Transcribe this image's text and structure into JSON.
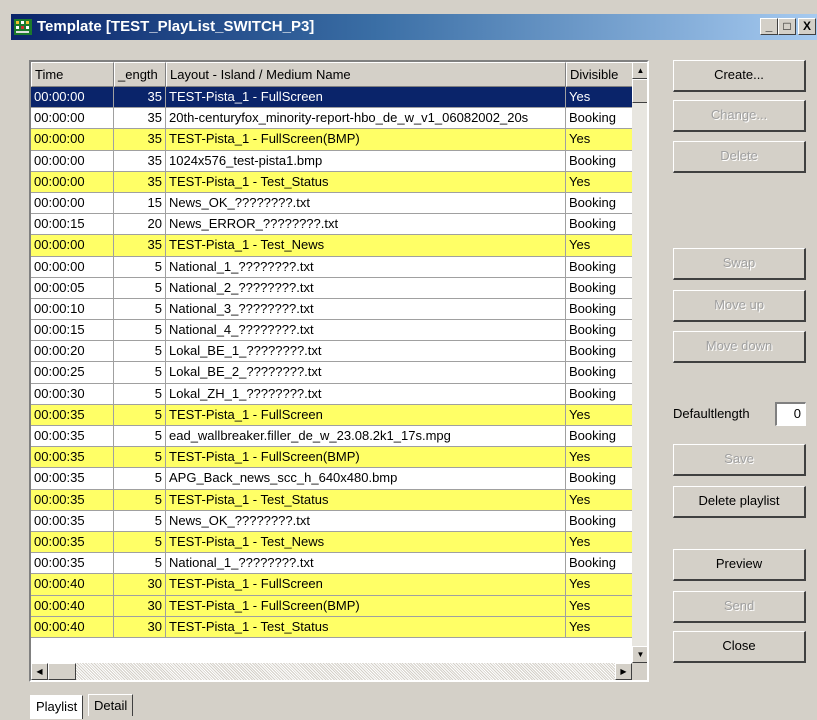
{
  "window": {
    "title": "Template [TEST_PlayList_SWITCH_P3]",
    "buttons": {
      "minimize": "_",
      "maximize": "□",
      "close": "X"
    }
  },
  "columns": [
    "Time",
    "_ength",
    "Layout - Island / Medium Name",
    "Divisible"
  ],
  "rows": [
    {
      "time": "00:00:00",
      "length": "35",
      "name": "TEST-Pista_1 - FullScreen",
      "divisible": "Yes",
      "style": "selected"
    },
    {
      "time": "00:00:00",
      "length": "35",
      "name": "20th-centuryfox_minority-report-hbo_de_w_v1_06082002_20s",
      "divisible": "Booking",
      "style": "white"
    },
    {
      "time": "00:00:00",
      "length": "35",
      "name": "TEST-Pista_1 - FullScreen(BMP)",
      "divisible": "Yes",
      "style": "yellow"
    },
    {
      "time": "00:00:00",
      "length": "35",
      "name": "1024x576_test-pista1.bmp",
      "divisible": "Booking",
      "style": "white"
    },
    {
      "time": "00:00:00",
      "length": "35",
      "name": "TEST-Pista_1 - Test_Status",
      "divisible": "Yes",
      "style": "yellow"
    },
    {
      "time": "00:00:00",
      "length": "15",
      "name": "News_OK_????????.txt",
      "divisible": "Booking",
      "style": "white"
    },
    {
      "time": "00:00:15",
      "length": "20",
      "name": "News_ERROR_????????.txt",
      "divisible": "Booking",
      "style": "white"
    },
    {
      "time": "00:00:00",
      "length": "35",
      "name": "TEST-Pista_1 - Test_News",
      "divisible": "Yes",
      "style": "yellow"
    },
    {
      "time": "00:00:00",
      "length": "5",
      "name": "National_1_????????.txt",
      "divisible": "Booking",
      "style": "white"
    },
    {
      "time": "00:00:05",
      "length": "5",
      "name": "National_2_????????.txt",
      "divisible": "Booking",
      "style": "white"
    },
    {
      "time": "00:00:10",
      "length": "5",
      "name": "National_3_????????.txt",
      "divisible": "Booking",
      "style": "white"
    },
    {
      "time": "00:00:15",
      "length": "5",
      "name": "National_4_????????.txt",
      "divisible": "Booking",
      "style": "white"
    },
    {
      "time": "00:00:20",
      "length": "5",
      "name": "Lokal_BE_1_????????.txt",
      "divisible": "Booking",
      "style": "white"
    },
    {
      "time": "00:00:25",
      "length": "5",
      "name": "Lokal_BE_2_????????.txt",
      "divisible": "Booking",
      "style": "white"
    },
    {
      "time": "00:00:30",
      "length": "5",
      "name": "Lokal_ZH_1_????????.txt",
      "divisible": "Booking",
      "style": "white"
    },
    {
      "time": "00:00:35",
      "length": "5",
      "name": "TEST-Pista_1 - FullScreen",
      "divisible": "Yes",
      "style": "yellow"
    },
    {
      "time": "00:00:35",
      "length": "5",
      "name": "ead_wallbreaker.filler_de_w_23.08.2k1_17s.mpg",
      "divisible": "Booking",
      "style": "white"
    },
    {
      "time": "00:00:35",
      "length": "5",
      "name": "TEST-Pista_1 - FullScreen(BMP)",
      "divisible": "Yes",
      "style": "yellow"
    },
    {
      "time": "00:00:35",
      "length": "5",
      "name": "APG_Back_news_scc_h_640x480.bmp",
      "divisible": "Booking",
      "style": "white"
    },
    {
      "time": "00:00:35",
      "length": "5",
      "name": "TEST-Pista_1 - Test_Status",
      "divisible": "Yes",
      "style": "yellow"
    },
    {
      "time": "00:00:35",
      "length": "5",
      "name": "News_OK_????????.txt",
      "divisible": "Booking",
      "style": "white"
    },
    {
      "time": "00:00:35",
      "length": "5",
      "name": "TEST-Pista_1 - Test_News",
      "divisible": "Yes",
      "style": "yellow"
    },
    {
      "time": "00:00:35",
      "length": "5",
      "name": "National_1_????????.txt",
      "divisible": "Booking",
      "style": "white"
    },
    {
      "time": "00:00:40",
      "length": "30",
      "name": "TEST-Pista_1 - FullScreen",
      "divisible": "Yes",
      "style": "yellow"
    },
    {
      "time": "00:00:40",
      "length": "30",
      "name": "TEST-Pista_1 - FullScreen(BMP)",
      "divisible": "Yes",
      "style": "yellow"
    },
    {
      "time": "00:00:40",
      "length": "30",
      "name": "TEST-Pista_1 - Test_Status",
      "divisible": "Yes",
      "style": "yellow"
    }
  ],
  "buttons": {
    "create": "Create...",
    "change": "Change...",
    "delete": "Delete",
    "swap": "Swap",
    "move_up": "Move up",
    "move_down": "Move down",
    "save": "Save",
    "delete_playlist": "Delete playlist",
    "preview": "Preview",
    "send": "Send",
    "close": "Close"
  },
  "default_length": {
    "label": "Defaultlength",
    "value": "0"
  },
  "tabs": [
    "Playlist",
    "Detail"
  ],
  "colors": {
    "row_highlight": "#ffff66",
    "selection": "#0a246a",
    "titlebar": "#0a246a"
  }
}
